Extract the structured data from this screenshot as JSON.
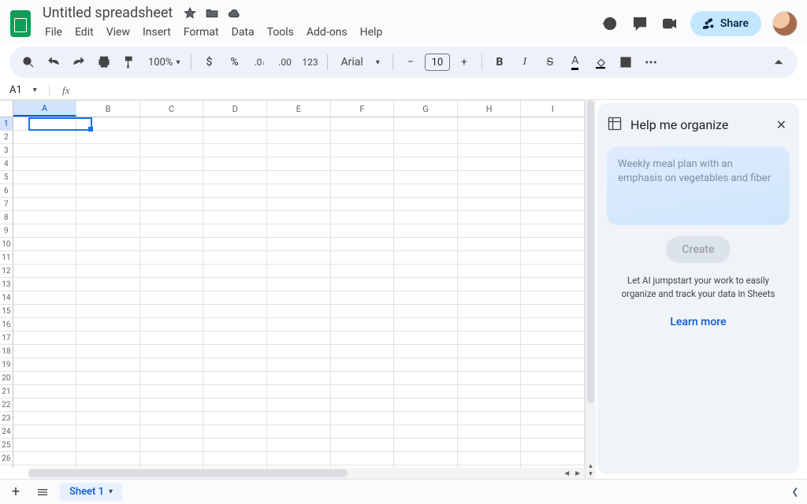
{
  "header": {
    "doc_title": "Untitled spreadsheet",
    "menus": [
      "File",
      "Edit",
      "View",
      "Insert",
      "Format",
      "Data",
      "Tools",
      "Add-ons",
      "Help"
    ],
    "share_label": "Share"
  },
  "toolbar": {
    "zoom": "100%",
    "font": "Arial",
    "font_size": "10"
  },
  "namebox": {
    "cell": "A1"
  },
  "grid": {
    "columns": [
      "A",
      "B",
      "C",
      "D",
      "E",
      "F",
      "G",
      "H",
      "I"
    ],
    "rows": 28,
    "selected_col": 0,
    "selected_row": 0
  },
  "sheet_tabs": {
    "active": "Sheet 1"
  },
  "side_panel": {
    "title": "Help me organize",
    "placeholder": "Weekly meal plan with an emphasis on vegetables and fiber",
    "create_label": "Create",
    "description": "Let AI jumpstart your work to easily organize and track your data in Sheets",
    "learn_more": "Learn more"
  }
}
